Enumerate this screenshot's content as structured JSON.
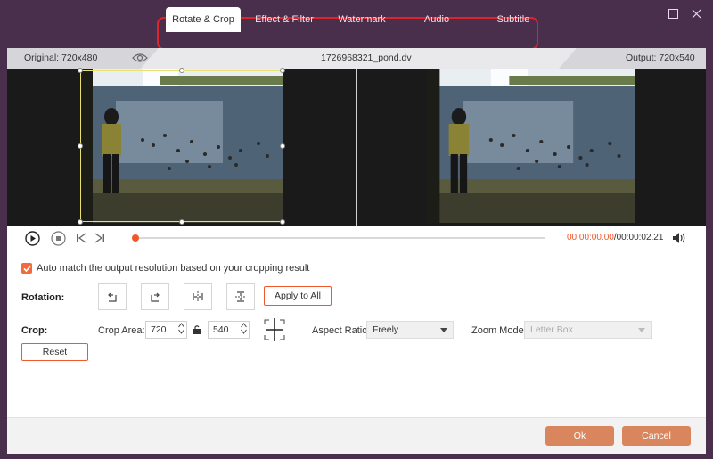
{
  "window": {
    "maximize_icon": "maximize-icon",
    "close_icon": "close-icon"
  },
  "tabs": [
    {
      "label": "Rotate & Crop",
      "active": true
    },
    {
      "label": "Effect & Filter",
      "active": false
    },
    {
      "label": "Watermark",
      "active": false
    },
    {
      "label": "Audio",
      "active": false
    },
    {
      "label": "Subtitle",
      "active": false
    }
  ],
  "info": {
    "original": "Original: 720x480",
    "filename": "1726968321_pond.dv",
    "output": "Output: 720x540"
  },
  "playback": {
    "current_time": "00:00:00.00",
    "total_time": "/00:00:02.21",
    "progress": 0
  },
  "options": {
    "auto_match_label": "Auto match the output resolution based on your cropping result",
    "auto_match_checked": true
  },
  "rotation": {
    "label": "Rotation:",
    "apply_all": "Apply to All"
  },
  "crop": {
    "label": "Crop:",
    "area_label": "Crop Area:",
    "width": "720",
    "height": "540",
    "aspect_label": "Aspect Ratio:",
    "aspect_value": "Freely",
    "zoom_label": "Zoom Mode:",
    "zoom_value": "Letter Box",
    "reset": "Reset"
  },
  "footer": {
    "ok": "Ok",
    "cancel": "Cancel"
  },
  "colors": {
    "accent": "#f0582a",
    "window_bg": "#4a2f4d",
    "highlight_border": "#e0222a",
    "primary_button": "#d9865e"
  }
}
